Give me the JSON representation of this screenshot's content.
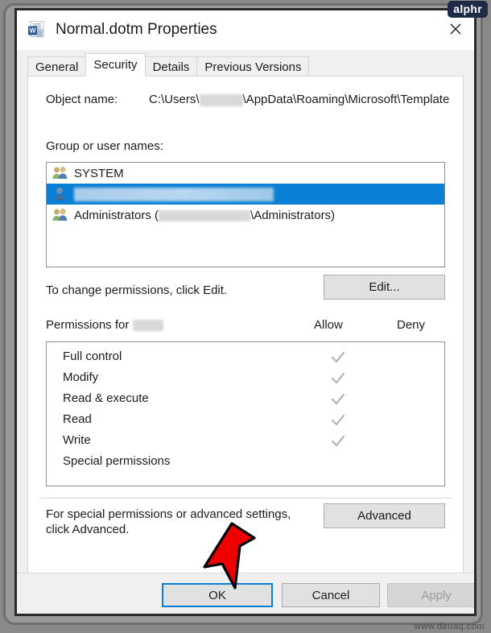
{
  "window": {
    "title": "Normal.dotm Properties",
    "icon": "word-template-icon",
    "close_label": "✕"
  },
  "tabs": [
    {
      "label": "General",
      "active": false
    },
    {
      "label": "Security",
      "active": true
    },
    {
      "label": "Details",
      "active": false
    },
    {
      "label": "Previous Versions",
      "active": false
    }
  ],
  "security": {
    "object_name_label": "Object name:",
    "object_name_value_prefix": "C:\\Users\\",
    "object_name_value_suffix": "\\AppData\\Roaming\\Microsoft\\Template",
    "group_label": "Group or user names:",
    "group_list": [
      {
        "name": "SYSTEM",
        "icon": "group-users-icon",
        "selected": false,
        "redacted": false
      },
      {
        "name": "",
        "icon": "single-user-icon",
        "selected": true,
        "redacted": true
      },
      {
        "name_prefix": "Administrators (",
        "name_suffix": "\\Administrators)",
        "icon": "group-users-icon",
        "selected": false,
        "redacted": true
      }
    ],
    "edit_hint": "To change permissions, click Edit.",
    "edit_button": "Edit...",
    "permissions_for_label": "Permissions for",
    "column_allow": "Allow",
    "column_deny": "Deny",
    "permissions": [
      {
        "name": "Full control",
        "allow": true,
        "deny": false
      },
      {
        "name": "Modify",
        "allow": true,
        "deny": false
      },
      {
        "name": "Read & execute",
        "allow": true,
        "deny": false
      },
      {
        "name": "Read",
        "allow": true,
        "deny": false
      },
      {
        "name": "Write",
        "allow": true,
        "deny": false
      },
      {
        "name": "Special permissions",
        "allow": false,
        "deny": false
      }
    ],
    "advanced_hint_line1": "For special permissions or advanced settings,",
    "advanced_hint_line2": "click Advanced.",
    "advanced_button": "Advanced"
  },
  "footer": {
    "ok": "OK",
    "cancel": "Cancel",
    "apply": "Apply",
    "apply_disabled": true
  },
  "annotations": {
    "arrow": "red-down-arrow-pointing-at-ok"
  },
  "watermarks": {
    "top_right": "alphr",
    "bottom_right": "www.deuaq.com"
  },
  "colors": {
    "selection_blue": "#0a7fd4",
    "focus_blue": "#0a7fd4",
    "arrow_red": "#ee0000",
    "checkmark_gray": "#b0b0b0",
    "dialog_bg": "#f0f0f0"
  }
}
